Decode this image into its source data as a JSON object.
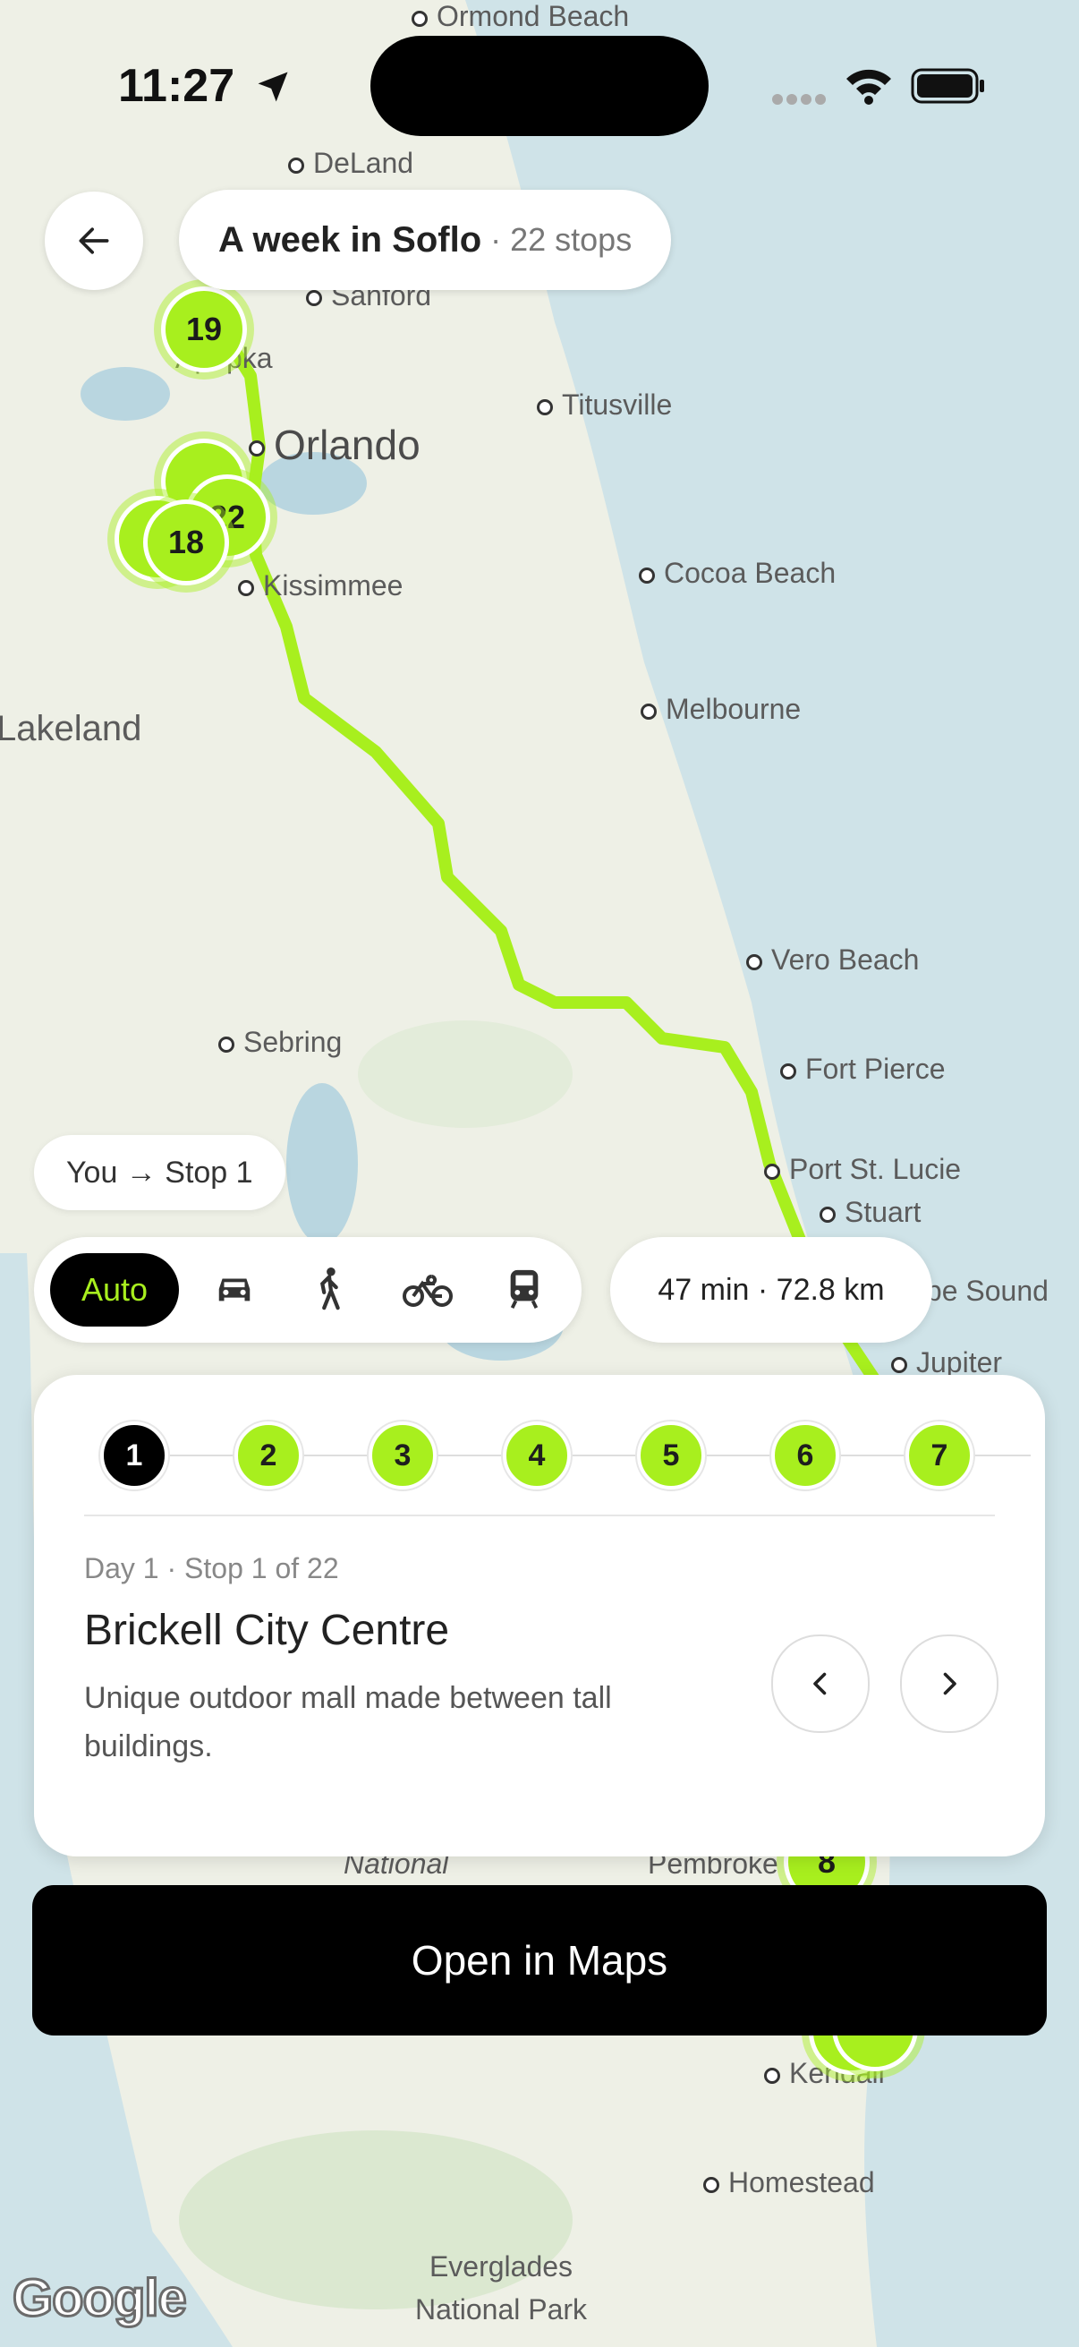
{
  "status_bar": {
    "time": "11:27"
  },
  "header": {
    "title": "A week in Soflo",
    "subtitle": "· 22 stops"
  },
  "map": {
    "places": [
      {
        "name": "Ormond Beach"
      },
      {
        "name": "DeLand"
      },
      {
        "name": "Sanford"
      },
      {
        "name": "Apopka"
      },
      {
        "name": "Orlando"
      },
      {
        "name": "Titusville"
      },
      {
        "name": "Kissimmee"
      },
      {
        "name": "Cocoa Beach"
      },
      {
        "name": "Lakeland"
      },
      {
        "name": "Melbourne"
      },
      {
        "name": "Vero Beach"
      },
      {
        "name": "Sebring"
      },
      {
        "name": "Fort Pierce"
      },
      {
        "name": "Port St. Lucie"
      },
      {
        "name": "Stuart"
      },
      {
        "name": "Hobe Sound"
      },
      {
        "name": "Jupiter"
      },
      {
        "name": "Pembroke"
      },
      {
        "name": "Kendall"
      },
      {
        "name": "Homestead"
      },
      {
        "name": "Everglades National Park"
      },
      {
        "name": "National"
      }
    ],
    "pins": [
      "19",
      "22",
      "18",
      "8"
    ],
    "route_color": "#a8ef1e",
    "attribution": "Google"
  },
  "route": {
    "chip": "You → Stop 1",
    "modes": [
      {
        "label": "Auto",
        "selected": true
      },
      {
        "icon": "car-icon"
      },
      {
        "icon": "walk-icon"
      },
      {
        "icon": "bike-icon"
      },
      {
        "icon": "transit-icon"
      }
    ],
    "eta": "47 min · 72.8 km"
  },
  "card": {
    "steps": [
      "1",
      "2",
      "3",
      "4",
      "5",
      "6",
      "7"
    ],
    "active_step": "1",
    "meta": "Day 1 · Stop 1 of 22",
    "title": "Brickell City Centre",
    "description": "Unique outdoor mall made between tall buildings."
  },
  "cta": {
    "label": "Open in Maps"
  },
  "colors": {
    "accent": "#a8ef1e",
    "dark": "#000000"
  }
}
